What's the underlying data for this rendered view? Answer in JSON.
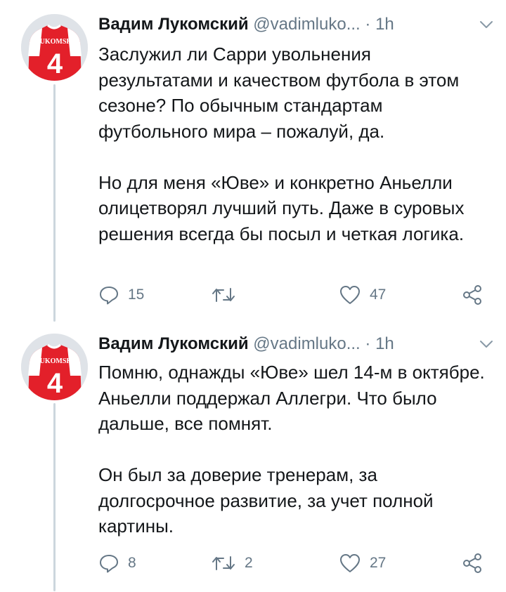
{
  "tweets": [
    {
      "author": {
        "name": "Вадим Лукомский",
        "handle": "@vadimluko...",
        "avatar": {
          "jersey_text": "LUKOMSKI",
          "number": "4"
        }
      },
      "separator": "·",
      "time": "1h",
      "paragraphs": [
        "Заслужил ли Сарри увольнения результатами и качеством футбола в этом сезоне? По обычным стандартам футбольного мира – пожалуй, да.",
        "Но для меня «Юве» и конкретно Аньелли олицетворял лучший путь. Даже в суровых решения всегда бы посыл и четкая логика."
      ],
      "actions": {
        "replies": "15",
        "retweets": "",
        "likes": "47"
      }
    },
    {
      "author": {
        "name": "Вадим Лукомский",
        "handle": "@vadimluko...",
        "avatar": {
          "jersey_text": "LUKOMSKI",
          "number": "4"
        }
      },
      "separator": "·",
      "time": "1h",
      "paragraphs": [
        "Помню, однажды «Юве» шел 14-м в октябре. Аньелли поддержал Аллегри. Что было дальше, все помнят.",
        "Он был за доверие тренерам, за долгосрочное развитие, за учет полной картины."
      ],
      "actions": {
        "replies": "8",
        "retweets": "2",
        "likes": "27"
      }
    }
  ],
  "colors": {
    "text": "#14171a",
    "secondary": "#657786",
    "thread_line": "#ccd6dd",
    "jersey_red": "#e3202a"
  },
  "icons": [
    "reply-icon",
    "retweet-icon",
    "like-icon",
    "share-icon",
    "chevron-down-icon"
  ]
}
